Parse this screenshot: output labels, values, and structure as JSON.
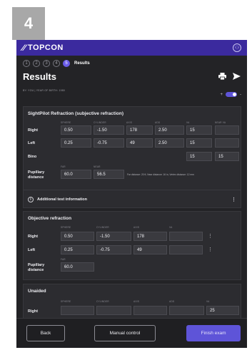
{
  "step_badge": "4",
  "topbar": {
    "logo": "TOPCON",
    "account_icon": "user-icon"
  },
  "steps": {
    "items": [
      "1",
      "2",
      "3",
      "4",
      "5"
    ],
    "active_label": "Results"
  },
  "header": {
    "title": "Results",
    "subtitle": "BY: YOU | YEAR OF BIRTH: 1980",
    "print_icon": "printer-icon",
    "send_icon": "send-icon",
    "toggle_minus": "-",
    "toggle_plus": "+"
  },
  "sightpilot": {
    "title": "SightPilot Refraction (subjective refraction)",
    "columns": [
      "SPHERE",
      "CYLINDER",
      "AXIS",
      "ADD",
      "VA",
      "NEAR VA"
    ],
    "rows": [
      {
        "label": "Right",
        "values": [
          "0.50",
          "-1.50",
          "178",
          "2.50",
          "15",
          ""
        ]
      },
      {
        "label": "Left",
        "values": [
          "0.25",
          "-0.75",
          "49",
          "2.50",
          "15",
          ""
        ]
      },
      {
        "label": "Bino",
        "values": [
          "",
          "",
          "",
          "",
          "15",
          "15"
        ]
      }
    ],
    "pd": {
      "label_1": "Pupillary",
      "label_2": "distance",
      "col_far": "FAR",
      "col_near": "NEAR",
      "far": "60.0",
      "near": "56.5",
      "note": "Far distance: 20 ft, Near distance: 16 in, Vertex distance: 12 mm"
    },
    "additional_info": "Additional test information"
  },
  "objective": {
    "title": "Objective refraction",
    "columns": [
      "SPHERE",
      "CYLINDER",
      "AXIS",
      "VA"
    ],
    "rows": [
      {
        "label": "Right",
        "values": [
          "0.50",
          "-1.50",
          "178",
          ""
        ]
      },
      {
        "label": "Left",
        "values": [
          "0.25",
          "-0.75",
          "49",
          ""
        ]
      }
    ],
    "pd": {
      "label_1": "Pupillary",
      "label_2": "distance",
      "col_far": "FAR",
      "far": "60.0"
    }
  },
  "unaided": {
    "title": "Unaided",
    "columns": [
      "SPHERE",
      "CYLINDER",
      "AXIS",
      "ADD",
      "VA"
    ],
    "rows": [
      {
        "label": "Right",
        "values": [
          "",
          "",
          "",
          "",
          "25"
        ]
      }
    ]
  },
  "footer": {
    "back": "Back",
    "manual": "Manual control",
    "finish": "Finish exam"
  }
}
